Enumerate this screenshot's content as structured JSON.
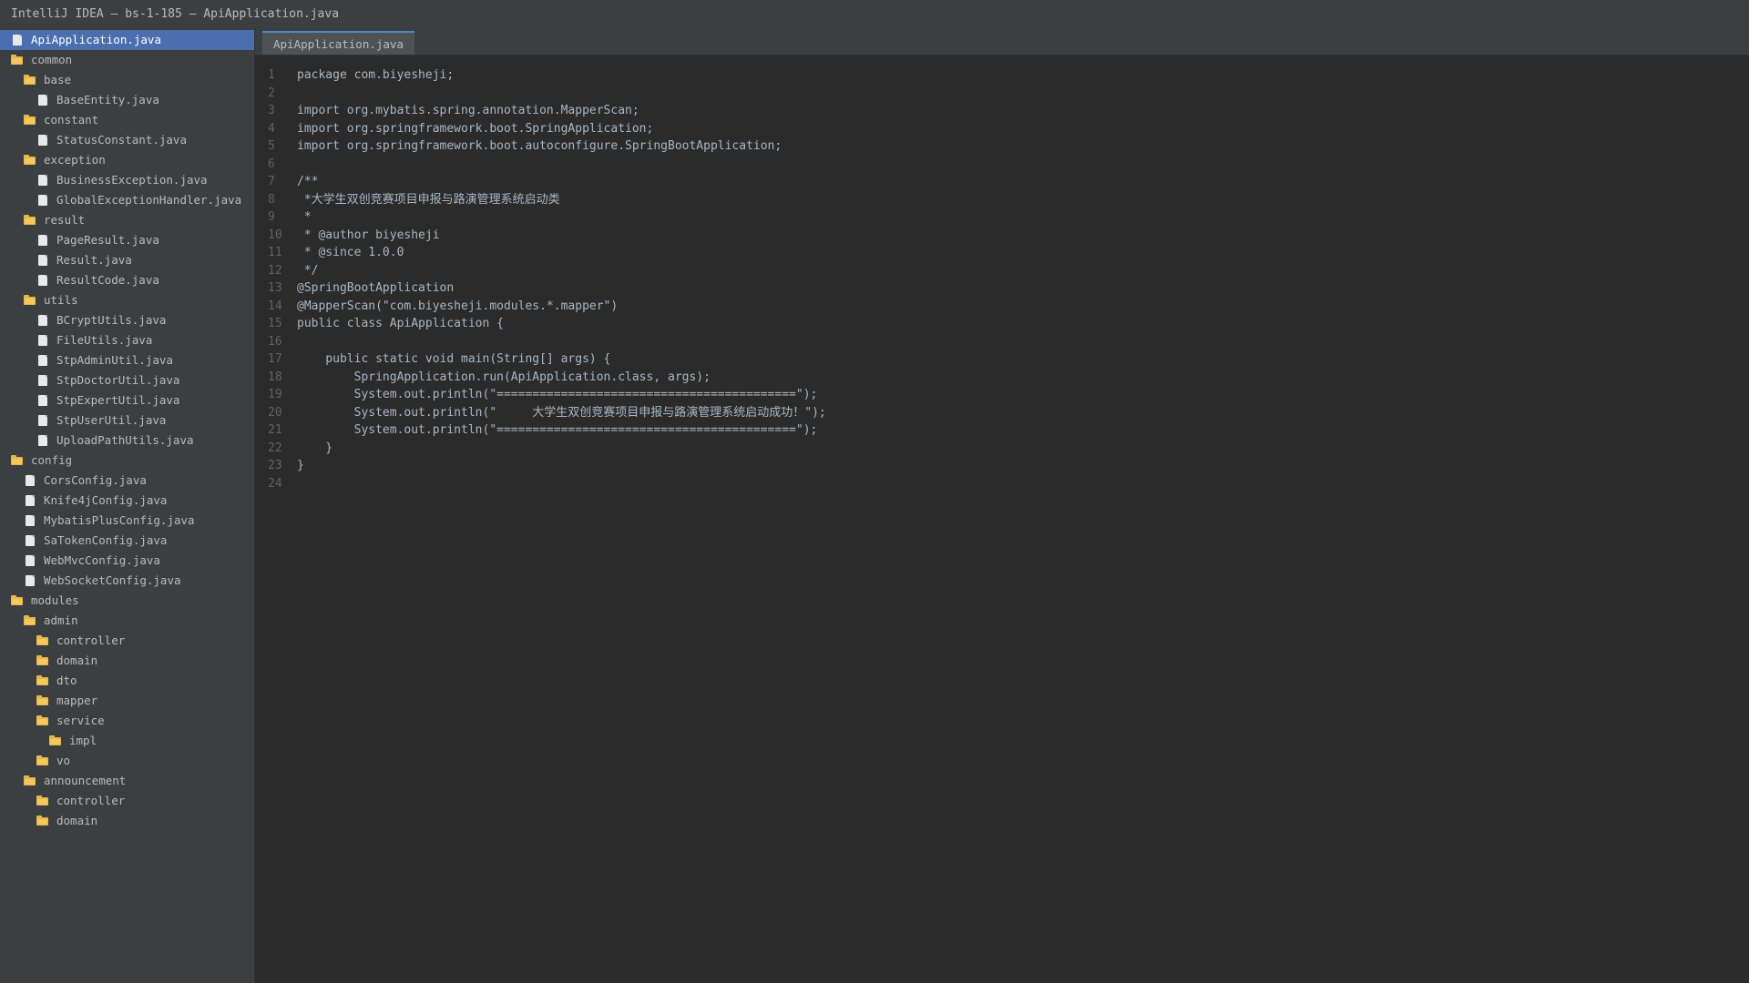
{
  "window": {
    "title": "IntelliJ IDEA — bs-1-185 — ApiApplication.java"
  },
  "sidebar": {
    "items": [
      {
        "label": "ApiApplication.java",
        "type": "file",
        "depth": 0,
        "selected": true
      },
      {
        "label": "common",
        "type": "folder",
        "depth": 0
      },
      {
        "label": "base",
        "type": "folder",
        "depth": 1
      },
      {
        "label": "BaseEntity.java",
        "type": "file",
        "depth": 2
      },
      {
        "label": "constant",
        "type": "folder",
        "depth": 1
      },
      {
        "label": "StatusConstant.java",
        "type": "file",
        "depth": 2
      },
      {
        "label": "exception",
        "type": "folder",
        "depth": 1
      },
      {
        "label": "BusinessException.java",
        "type": "file",
        "depth": 2
      },
      {
        "label": "GlobalExceptionHandler.java",
        "type": "file",
        "depth": 2
      },
      {
        "label": "result",
        "type": "folder",
        "depth": 1
      },
      {
        "label": "PageResult.java",
        "type": "file",
        "depth": 2
      },
      {
        "label": "Result.java",
        "type": "file",
        "depth": 2
      },
      {
        "label": "ResultCode.java",
        "type": "file",
        "depth": 2
      },
      {
        "label": "utils",
        "type": "folder",
        "depth": 1
      },
      {
        "label": "BCryptUtils.java",
        "type": "file",
        "depth": 2
      },
      {
        "label": "FileUtils.java",
        "type": "file",
        "depth": 2
      },
      {
        "label": "StpAdminUtil.java",
        "type": "file",
        "depth": 2
      },
      {
        "label": "StpDoctorUtil.java",
        "type": "file",
        "depth": 2
      },
      {
        "label": "StpExpertUtil.java",
        "type": "file",
        "depth": 2
      },
      {
        "label": "StpUserUtil.java",
        "type": "file",
        "depth": 2
      },
      {
        "label": "UploadPathUtils.java",
        "type": "file",
        "depth": 2
      },
      {
        "label": "config",
        "type": "folder",
        "depth": 0
      },
      {
        "label": "CorsConfig.java",
        "type": "file",
        "depth": 1
      },
      {
        "label": "Knife4jConfig.java",
        "type": "file",
        "depth": 1
      },
      {
        "label": "MybatisPlusConfig.java",
        "type": "file",
        "depth": 1
      },
      {
        "label": "SaTokenConfig.java",
        "type": "file",
        "depth": 1
      },
      {
        "label": "WebMvcConfig.java",
        "type": "file",
        "depth": 1
      },
      {
        "label": "WebSocketConfig.java",
        "type": "file",
        "depth": 1
      },
      {
        "label": "modules",
        "type": "folder",
        "depth": 0
      },
      {
        "label": "admin",
        "type": "folder",
        "depth": 1
      },
      {
        "label": "controller",
        "type": "folder",
        "depth": 2
      },
      {
        "label": "domain",
        "type": "folder",
        "depth": 2
      },
      {
        "label": "dto",
        "type": "folder",
        "depth": 2
      },
      {
        "label": "mapper",
        "type": "folder",
        "depth": 2
      },
      {
        "label": "service",
        "type": "folder",
        "depth": 2
      },
      {
        "label": "impl",
        "type": "folder",
        "depth": 3
      },
      {
        "label": "vo",
        "type": "folder",
        "depth": 2
      },
      {
        "label": "announcement",
        "type": "folder",
        "depth": 1
      },
      {
        "label": "controller",
        "type": "folder",
        "depth": 2
      },
      {
        "label": "domain",
        "type": "folder",
        "depth": 2
      }
    ]
  },
  "editor": {
    "tabs": [
      {
        "label": "ApiApplication.java",
        "active": true
      }
    ],
    "lines": [
      "package com.biyesheji;",
      "",
      "import org.mybatis.spring.annotation.MapperScan;",
      "import org.springframework.boot.SpringApplication;",
      "import org.springframework.boot.autoconfigure.SpringBootApplication;",
      "",
      "/**",
      " *大学生双创竞赛项目申报与路演管理系统启动类",
      " *",
      " * @author biyesheji",
      " * @since 1.0.0",
      " */",
      "@SpringBootApplication",
      "@MapperScan(\"com.biyesheji.modules.*.mapper\")",
      "public class ApiApplication {",
      "",
      "    public static void main(String[] args) {",
      "        SpringApplication.run(ApiApplication.class, args);",
      "        System.out.println(\"==========================================\");",
      "        System.out.println(\"     大学生双创竞赛项目申报与路演管理系统启动成功！\");",
      "        System.out.println(\"==========================================\");",
      "    }",
      "}",
      ""
    ]
  },
  "colors": {
    "selection": "#4b6eaf",
    "folder": "#e8b64a",
    "file": "#e9e9e9",
    "code_text": "#a9b7c6",
    "line_number": "#606366",
    "editor_bg": "#2b2b2b",
    "panel_bg": "#3c3f41"
  }
}
